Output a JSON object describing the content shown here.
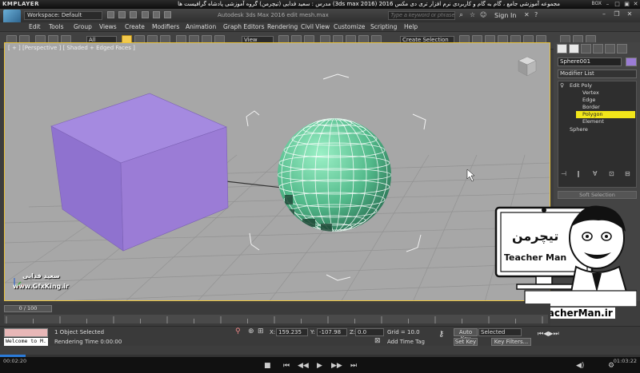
{
  "player": {
    "logo": "KMPLAYER",
    "title": "مجموعه آموزشی جامع ، گام به گام و کاربردی نرم افزار تری دی مکس 2016 (3ds max 2016) مدرس : سعید فدایی (تیچرمن) گروه آموزشی پادشاه گرافیست ها",
    "box_label": "BOX",
    "time_elapsed": "00:02:20",
    "time_total": "01:03:22",
    "progress_fraction": 0.04
  },
  "max": {
    "logo": "MAX",
    "workspace": "Workspace: Default",
    "app_title": "Autodesk 3ds Max 2016    edit mesh.max",
    "search_placeholder": "Type a keyword or phrase",
    "sign_in": "Sign In",
    "menus": [
      "Edit",
      "Tools",
      "Group",
      "Views",
      "Create",
      "Modifiers",
      "Animation",
      "Graph Editors",
      "Rendering",
      "Civil View",
      "Customize",
      "Scripting",
      "Help"
    ],
    "toolbar": {
      "filter_value": "All",
      "ref_coord_value": "View",
      "selection_set_placeholder": "Create Selection Se"
    },
    "viewport_label": "[ + ] [Perspective ] [ Shaded + Edged Faces ]"
  },
  "command_panel": {
    "object_name": "Sphere001",
    "modifier_list": "Modifier List",
    "stack": [
      {
        "label": "Edit Poly",
        "selected": false
      },
      {
        "label": "Vertex",
        "selected": false
      },
      {
        "label": "Edge",
        "selected": false
      },
      {
        "label": "Border",
        "selected": false
      },
      {
        "label": "Polygon",
        "selected": true
      },
      {
        "label": "Element",
        "selected": false
      },
      {
        "label": "Sphere",
        "selected": false
      }
    ],
    "rollout_soft_selection": "Soft Selection"
  },
  "timeline": {
    "frame_slider": "0 / 100"
  },
  "status": {
    "welcome": "Welcome to M.",
    "selection_text": "1 Object Selected",
    "rendering_time": "Rendering Time  0:00:00",
    "x_label": "X:",
    "x_value": "159.235",
    "y_label": "Y:",
    "y_value": "-107.98",
    "z_label": "Z:",
    "z_value": "0.0",
    "grid": "Grid = 10.0",
    "add_time_tag": "Add Time Tag",
    "auto_key": "Auto Key",
    "selected_dropdown": "Selected",
    "set_key": "Set Key",
    "key_filters": "Key Filters..."
  },
  "watermarks": {
    "author": "سعید فدایی",
    "gfxking": "www.GfxKing.ir",
    "teacherman_site": "www.TeacherMan.ir",
    "teacherman_fa": "تیچرمن",
    "teacherman_en": "Teacher Man"
  },
  "colors": {
    "box": "#9b7cd6",
    "sphere": "#5ec39a",
    "viewport_bg": "#a7a7a7",
    "selection_yellow": "#f2e61a",
    "active_border": "#e9c33b"
  }
}
